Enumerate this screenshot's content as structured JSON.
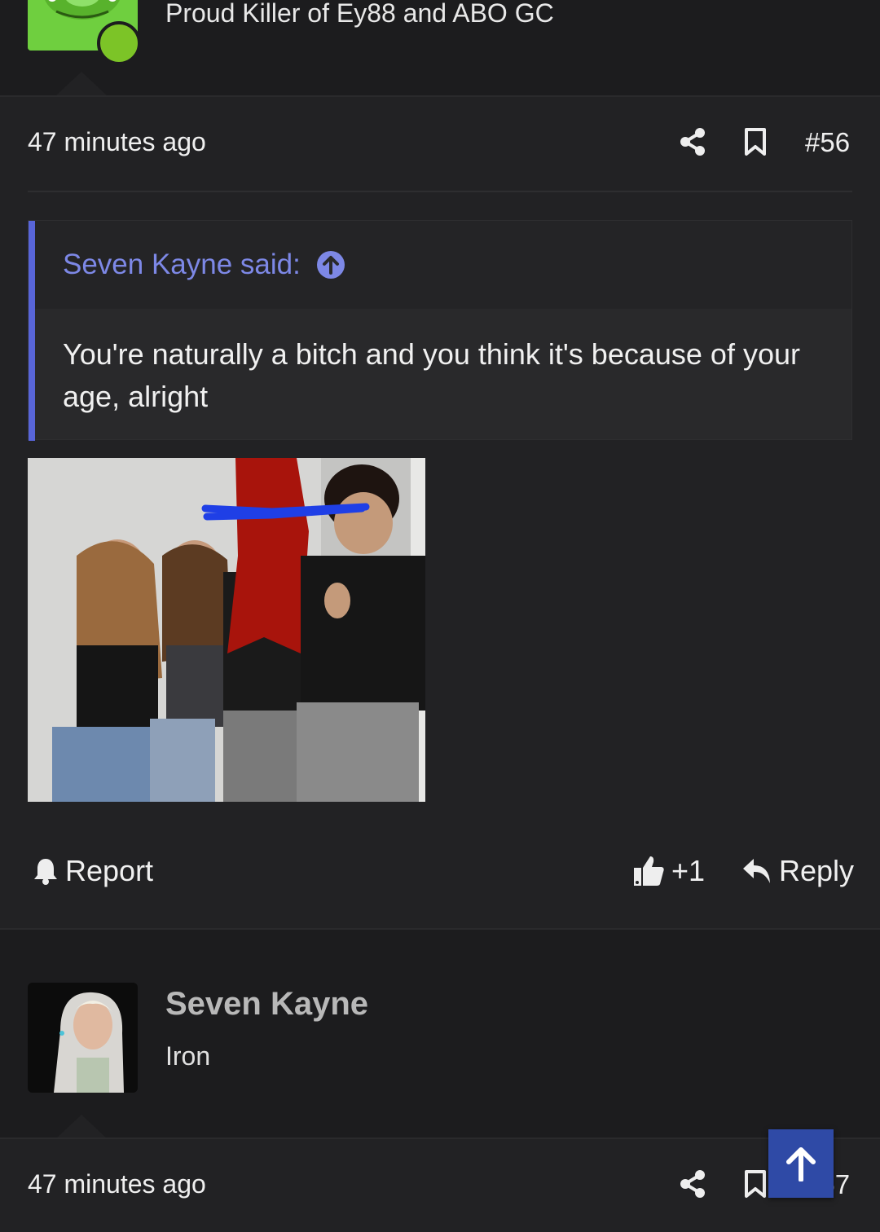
{
  "post1": {
    "user_title": "Proud Killer of Ey88 and ABO GC",
    "time": "47 minutes ago",
    "post_number": "#56",
    "quote": {
      "author": "Seven Kayne said:",
      "text": "You're naturally a bitch and you think it's because of your age, alright"
    },
    "actions": {
      "report": "Report",
      "reaction_count": "+1",
      "reply": "Reply"
    }
  },
  "post2": {
    "username": "Seven Kayne",
    "rank": "Iron",
    "time": "47 minutes ago",
    "post_number": "#57"
  },
  "icons": {
    "share": "share-icon",
    "bookmark": "bookmark-icon",
    "quote_jump": "arrow-up-circle-icon",
    "report": "bell-icon",
    "like": "thumbs-up-icon",
    "reply": "reply-icon",
    "scroll_top": "arrow-up-icon"
  },
  "colors": {
    "accent": "#5865d8",
    "quote_author": "#7d88e6",
    "online": "#7cc427",
    "scroll_button": "#2f4aa6"
  }
}
